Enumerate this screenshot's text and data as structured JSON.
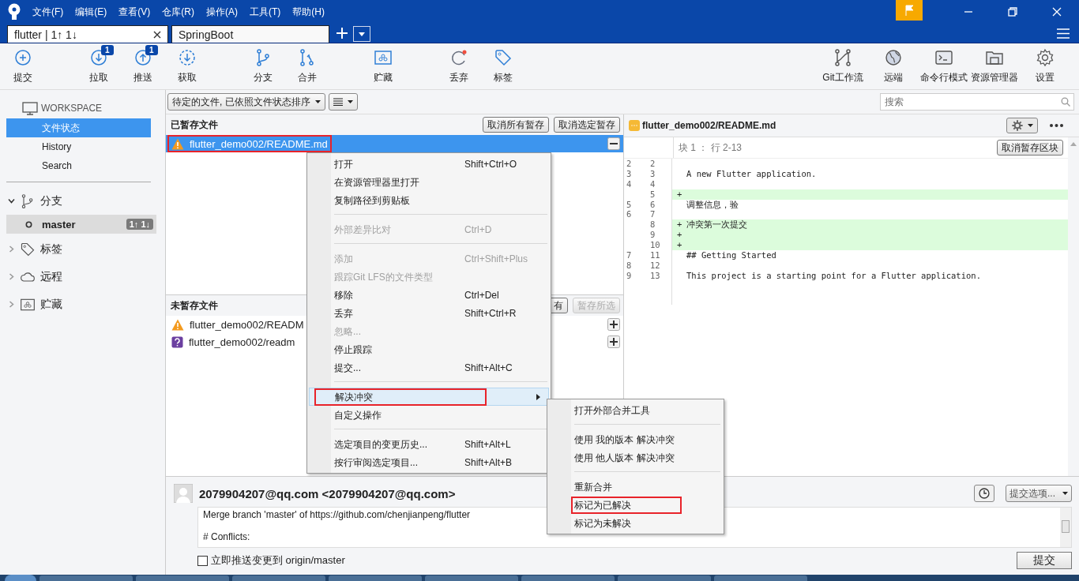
{
  "window": {
    "menu": [
      "文件(F)",
      "编辑(E)",
      "查看(V)",
      "仓库(R)",
      "操作(A)",
      "工具(T)",
      "帮助(H)"
    ]
  },
  "tabs": [
    {
      "label": "flutter | 1↑ 1↓",
      "selected": true
    },
    {
      "label": "SpringBoot",
      "selected": false
    }
  ],
  "toolbar": {
    "left": [
      {
        "label": "提交"
      },
      {
        "label": "拉取",
        "badge": "1"
      },
      {
        "label": "推送",
        "badge": "1"
      },
      {
        "label": "获取"
      },
      {
        "label": "分支"
      },
      {
        "label": "合并"
      },
      {
        "label": "贮藏"
      },
      {
        "label": "丢弃"
      },
      {
        "label": "标签"
      }
    ],
    "right": [
      {
        "label": "Git工作流"
      },
      {
        "label": "远端"
      },
      {
        "label": "命令行模式"
      },
      {
        "label": "资源管理器"
      },
      {
        "label": "设置"
      }
    ]
  },
  "sidebar": {
    "workspace": "WORKSPACE",
    "items": [
      {
        "label": "文件状态",
        "selected": true
      },
      {
        "label": "History",
        "selected": false
      },
      {
        "label": "Search",
        "selected": false
      }
    ],
    "sections": [
      {
        "label": "分支",
        "expanded": true,
        "children": [
          {
            "label": "master",
            "badge": "1↑ 1↓"
          }
        ]
      },
      {
        "label": "标签",
        "expanded": false
      },
      {
        "label": "远程",
        "expanded": false
      },
      {
        "label": "贮藏",
        "expanded": false
      }
    ]
  },
  "filter": {
    "sort": "待定的文件, 已依照文件状态排序",
    "search_placeholder": "搜索"
  },
  "staged": {
    "title": "已暂存文件",
    "buttons": [
      {
        "label": "取消所有暂存",
        "disabled": false
      },
      {
        "label": "取消选定暂存",
        "disabled": false
      }
    ],
    "files": [
      {
        "name": "flutter_demo002/README.md",
        "kind": "conflict",
        "selected": true,
        "annotated": true
      }
    ]
  },
  "unstaged": {
    "title": "未暂存文件",
    "buttons": [
      {
        "label": "有",
        "disabled": false
      },
      {
        "label": "暂存所选",
        "disabled": true
      }
    ],
    "files": [
      {
        "name": "flutter_demo002/READM",
        "kind": "conflict",
        "selected": false,
        "annotated": false
      },
      {
        "name": "flutter_demo002/readm",
        "kind": "untracked",
        "selected": false,
        "annotated": false
      }
    ]
  },
  "diff": {
    "file": "flutter_demo002/README.md",
    "hunk": "块 1 ： 行 2-13",
    "hunk_button": "取消暂存区块",
    "lines": [
      {
        "old": "2",
        "new": "2",
        "kind": "context"
      },
      {
        "old": "3",
        "new": "3",
        "kind": "context",
        "text": "A new Flutter application."
      },
      {
        "old": "4",
        "new": "4",
        "kind": "context"
      },
      {
        "new": "5",
        "kind": "added",
        "sign": "+"
      },
      {
        "old": "5",
        "new": "6",
        "kind": "context",
        "text": "调整信息，验"
      },
      {
        "old": "6",
        "new": "7",
        "kind": "context"
      },
      {
        "new": "8",
        "kind": "added",
        "sign": "+",
        "text": "冲突第一次提交"
      },
      {
        "new": "9",
        "kind": "added",
        "sign": "+"
      },
      {
        "new": "10",
        "kind": "added",
        "sign": "+"
      },
      {
        "old": "7",
        "new": "11",
        "kind": "context",
        "text": "## Getting Started"
      },
      {
        "old": "8",
        "new": "12",
        "kind": "context"
      },
      {
        "old": "9",
        "new": "13",
        "kind": "context",
        "text": "This project is a starting point for a Flutter application."
      }
    ]
  },
  "commit": {
    "author": "2079904207@qq.com <2079904207@qq.com>",
    "message": "Merge branch 'master' of https://github.com/chenjianpeng/flutter\n\n# Conflicts:",
    "options_button": "提交选项...",
    "push": {
      "label": "立即推送变更到 origin/master",
      "checked": false
    },
    "commit_button": "提交"
  },
  "context_menu": {
    "items": [
      {
        "kind": "item",
        "label": "打开",
        "shortcut": "Shift+Ctrl+O",
        "disabled": false
      },
      {
        "kind": "item",
        "label": "在资源管理器里打开",
        "disabled": false
      },
      {
        "kind": "item",
        "label": "复制路径到剪贴板",
        "disabled": false
      },
      {
        "kind": "separator"
      },
      {
        "kind": "item",
        "label": "外部差异比对",
        "shortcut": "Ctrl+D",
        "disabled": true
      },
      {
        "kind": "separator"
      },
      {
        "kind": "item",
        "label": "添加",
        "shortcut": "Ctrl+Shift+Plus",
        "disabled": true
      },
      {
        "kind": "item",
        "label": "跟踪Git LFS的文件类型",
        "disabled": true
      },
      {
        "kind": "item",
        "label": "移除",
        "shortcut": "Ctrl+Del",
        "disabled": false
      },
      {
        "kind": "item",
        "label": "丢弃",
        "shortcut": "Shift+Ctrl+R",
        "disabled": false
      },
      {
        "kind": "item",
        "label": "忽略...",
        "disabled": true
      },
      {
        "kind": "item",
        "label": "停止跟踪",
        "disabled": false
      },
      {
        "kind": "item",
        "label": "提交...",
        "shortcut": "Shift+Alt+C",
        "disabled": false
      },
      {
        "kind": "separator"
      },
      {
        "kind": "item",
        "label": "解决冲突",
        "disabled": false,
        "submenu": true,
        "selected": true,
        "annotated": true
      },
      {
        "kind": "item",
        "label": "自定义操作",
        "disabled": false
      },
      {
        "kind": "separator"
      },
      {
        "kind": "item",
        "label": "选定项目的变更历史...",
        "shortcut": "Shift+Alt+L",
        "disabled": false
      },
      {
        "kind": "item",
        "label": "按行审阅选定项目...",
        "shortcut": "Shift+Alt+B",
        "disabled": false
      }
    ]
  },
  "submenu": {
    "items": [
      {
        "kind": "item",
        "label": "打开外部合并工具"
      },
      {
        "kind": "separator"
      },
      {
        "kind": "item",
        "label": "使用 我的版本 解决冲突"
      },
      {
        "kind": "item",
        "label": "使用 他人版本 解决冲突"
      },
      {
        "kind": "separator"
      },
      {
        "kind": "item",
        "label": "重新合并"
      },
      {
        "kind": "item",
        "label": "标记为已解决",
        "annotated": true
      },
      {
        "kind": "item",
        "label": "标记为未解决"
      }
    ]
  }
}
